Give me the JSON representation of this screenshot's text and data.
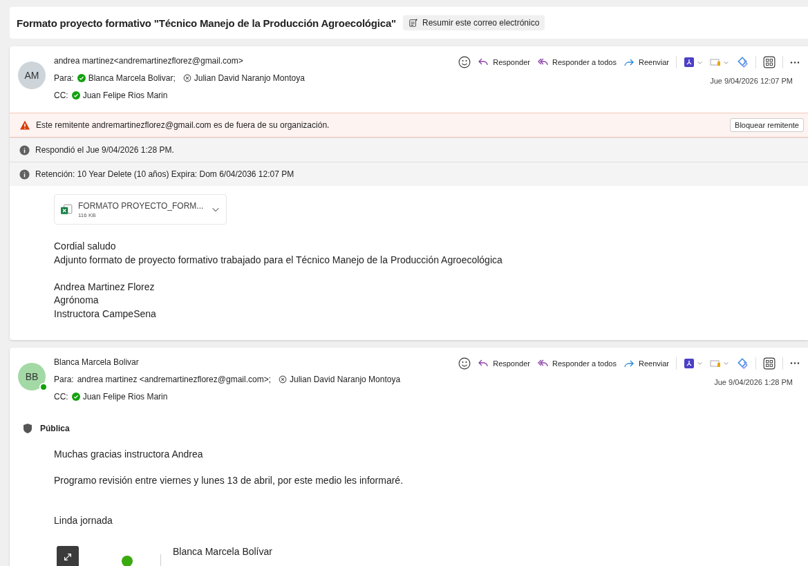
{
  "subject": {
    "title": "Formato proyecto formativo \"Técnico Manejo de la Producción Agroecológica\"",
    "summarize": "Resumir este correo electrónico"
  },
  "messages": [
    {
      "avatar": {
        "initials": "AM",
        "color": "#cdd5da",
        "online": false
      },
      "sender": "andrea martinez<andremartinezflorez@gmail.com>",
      "to_label": "Para:",
      "to": [
        {
          "name": "Blanca Marcela Bolivar;",
          "kind": "verified"
        },
        {
          "name": "Julian David Naranjo Montoya",
          "kind": "unknown"
        }
      ],
      "cc_label": "CC:",
      "cc": [
        {
          "name": "Juan Felipe Rios Marin",
          "kind": "verified"
        }
      ],
      "actions": [
        {
          "label": "Responder",
          "kind": "reply"
        },
        {
          "label": "Responder a todos",
          "kind": "reply-all"
        },
        {
          "label": "Reenviar",
          "kind": "forward"
        }
      ],
      "date": "Jue 9/04/2026 12:07 PM",
      "banners": [
        {
          "kind": "warning",
          "text": "Este remitente andremartinezflorez@gmail.com es de fuera de su organización.",
          "button": "Bloquear remitente"
        },
        {
          "kind": "info",
          "text": "Respondió el Jue 9/04/2026 1:28 PM."
        },
        {
          "kind": "info",
          "text": "Retención: 10 Year Delete (10 años) Expira: Dom 6/04/2036 12:07 PM"
        }
      ],
      "attachments": [
        {
          "name": "FORMATO PROYECTO_FORM...",
          "size": "116 KB"
        }
      ],
      "body": [
        [
          "Cordial saludo",
          "Adjunto formato de proyecto formativo trabajado para el Técnico Manejo de la Producción Agroecológica"
        ],
        [
          "Andrea Martinez Florez",
          "Agrónoma",
          "Instructora CampeSena"
        ]
      ]
    },
    {
      "avatar": {
        "initials": "BB",
        "color": "#a3d9a5",
        "online": true
      },
      "sender": "Blanca Marcela Bolivar",
      "to_label": "Para:",
      "to": [
        {
          "name": "andrea martinez <andremartinezflorez@gmail.com>;",
          "kind": "plain"
        },
        {
          "name": "Julian David Naranjo Montoya",
          "kind": "unknown"
        }
      ],
      "cc_label": "CC:",
      "cc": [
        {
          "name": "Juan Felipe Rios Marin",
          "kind": "verified"
        }
      ],
      "actions": [
        {
          "label": "Responder",
          "kind": "reply"
        },
        {
          "label": "Responder a todos",
          "kind": "reply-all"
        },
        {
          "label": "Reenviar",
          "kind": "forward"
        }
      ],
      "date": "Jue 9/04/2026 1:28 PM",
      "sensitivity": "Pública",
      "body": [
        [
          "Muchas gracias instructora Andrea"
        ],
        [
          "Programo revisión entre viernes y lunes 13 de abril, por este medio les informaré."
        ],
        [
          "Linda jornada"
        ]
      ],
      "signature": {
        "name": "Blanca Marcela Bolívar"
      }
    }
  ]
}
